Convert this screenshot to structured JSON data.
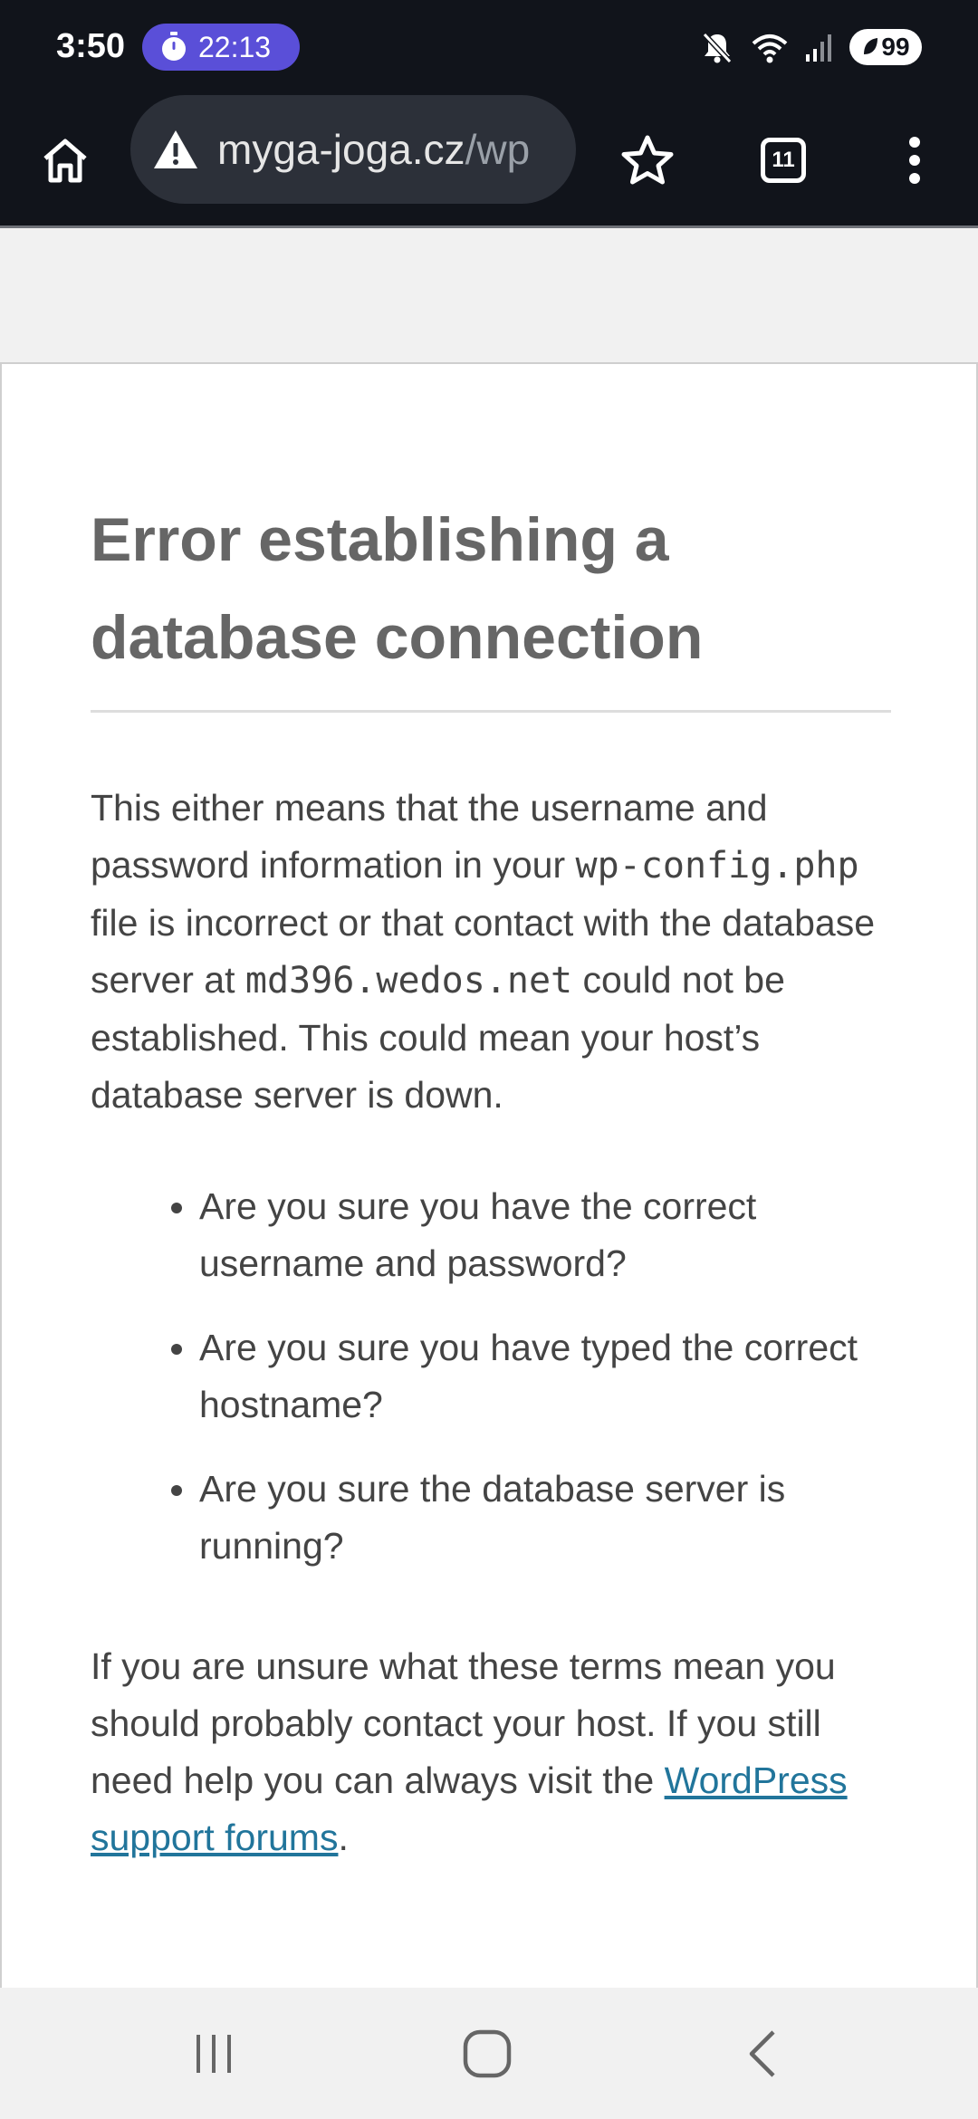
{
  "status_bar": {
    "time": "3:50",
    "timer": "22:13",
    "battery": "99"
  },
  "browser": {
    "url_domain": "myga-joga.cz",
    "url_path": "/wp",
    "tab_count": "11"
  },
  "error_page": {
    "title": "Error establishing a database connection",
    "body": {
      "part1": "This either means that the username and password information in your ",
      "config_file": "wp-config.php",
      "part2": " file is incorrect or that contact with the database server at ",
      "db_host": "md396.wedos.net",
      "part3": " could not be established. This could mean your host’s database server is down."
    },
    "questions": [
      "Are you sure you have the correct username and password?",
      "Are you sure you have typed the correct hostname?",
      "Are you sure the database server is running?"
    ],
    "help": {
      "text": "If you are unsure what these terms mean you should probably contact your host. If you still need help you can always visit the ",
      "link_text": "WordPress support forums",
      "suffix": "."
    }
  },
  "colors": {
    "chrome_bg": "#11141b",
    "timer_accent": "#5a4fd8",
    "title_text": "#666666",
    "body_text": "#444444",
    "link": "#21759b"
  },
  "icons": {
    "status": [
      "stopwatch-icon",
      "mute-icon",
      "wifi-icon",
      "signal-icon",
      "battery-saver-icon"
    ],
    "toolbar": [
      "home-icon",
      "warning-icon",
      "star-icon",
      "tabs-icon",
      "more-vert-icon"
    ],
    "nav": [
      "recents-icon",
      "home-circle-icon",
      "back-icon"
    ]
  }
}
